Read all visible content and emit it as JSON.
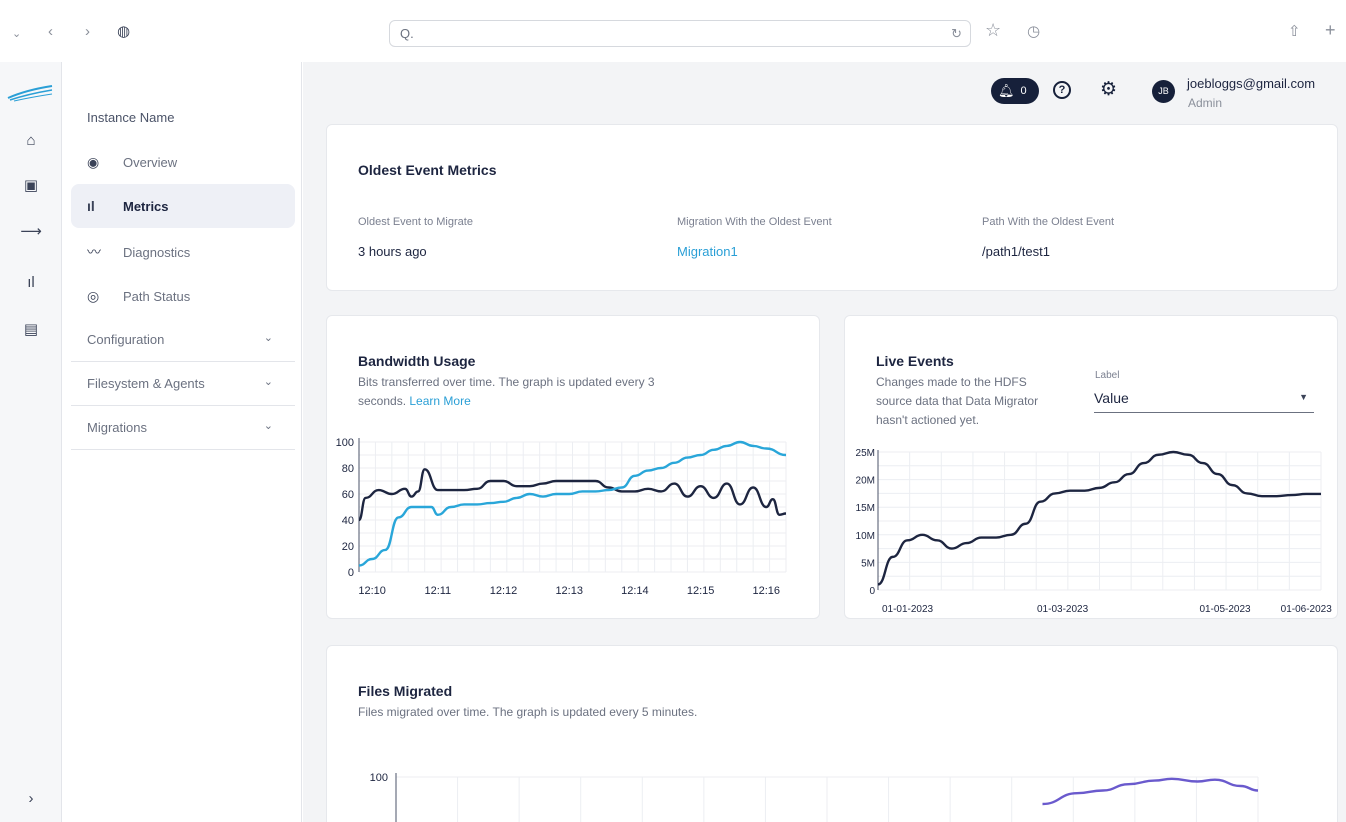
{
  "browser": {
    "url_text": "Q.",
    "icons": [
      "chevron-down-icon",
      "back-icon",
      "forward-icon",
      "globe-icon",
      "reload-icon",
      "star-icon",
      "history-icon",
      "share-icon",
      "new-tab-icon"
    ]
  },
  "rail": {
    "icons": [
      "logo-icon",
      "home-icon",
      "briefcase-icon",
      "arrow-right-icon",
      "bar-chart-icon",
      "document-icon",
      "expand-icon"
    ]
  },
  "sidebar": {
    "instance_name": "Instance Name",
    "items": [
      {
        "label": "Overview",
        "icon": "eye-icon"
      },
      {
        "label": "Metrics",
        "icon": "bar-chart-icon",
        "active": true
      },
      {
        "label": "Diagnostics",
        "icon": "trend-icon"
      },
      {
        "label": "Path Status",
        "icon": "target-icon"
      }
    ],
    "sections": [
      {
        "label": "Configuration"
      },
      {
        "label": "Filesystem & Agents"
      },
      {
        "label": "Migrations"
      }
    ]
  },
  "topbar": {
    "notification_count": "0",
    "avatar_initials": "JB",
    "user_email": "joebloggs@gmail.com",
    "user_role": "Admin"
  },
  "oldest": {
    "title": "Oldest Event Metrics",
    "metrics": [
      {
        "label": "Oldest Event to Migrate",
        "value": "3 hours ago"
      },
      {
        "label": "Migration With the Oldest Event",
        "value": "Migration1"
      },
      {
        "label": "Path With the Oldest Event",
        "value": "/path1/test1"
      }
    ]
  },
  "bandwidth": {
    "title": "Bandwidth Usage",
    "desc_line1": "Bits transferred over time. The graph is updated every 3",
    "desc_line2": "seconds.",
    "link": "Learn More"
  },
  "live_events": {
    "title": "Live Events",
    "desc_line1": "Changes made to the HDFS",
    "desc_line2": "source data that Data Migrator",
    "desc_line3": "hasn't actioned yet.",
    "select_label": "Label",
    "select_value": "Value"
  },
  "files": {
    "title": "Files Migrated",
    "desc": "Files migrated over time. The graph is updated every 5 minutes."
  },
  "colors": {
    "accent": "#2a9fd6",
    "navy": "#16203a",
    "purple": "#6a5acd"
  },
  "chart_data": [
    {
      "type": "line",
      "ylim": [
        0,
        100
      ],
      "yticks": [
        0,
        20,
        40,
        60,
        80,
        100
      ],
      "xticks": [
        "12:10",
        "12:11",
        "12:12",
        "12:13",
        "12:14",
        "12:15",
        "12:16"
      ],
      "grid": true,
      "series": [
        {
          "color": "#1d2540",
          "x": [
            0,
            0.1,
            0.3,
            0.5,
            0.7,
            0.8,
            0.9,
            1.0,
            1.2,
            1.4,
            1.6,
            1.8,
            2.0,
            2.2,
            2.4,
            2.6,
            2.8,
            3.0,
            3.2,
            3.4,
            3.6,
            3.8,
            4.0,
            4.2,
            4.4,
            4.6,
            4.8,
            5.0,
            5.2,
            5.4,
            5.6,
            5.8,
            6.0,
            6.2,
            6.3,
            6.4,
            6.5
          ],
          "y": [
            40,
            57,
            63,
            60,
            64,
            58,
            62,
            79,
            63,
            63,
            63,
            64,
            70,
            70,
            66,
            66,
            68,
            70,
            70,
            70,
            70,
            65,
            62,
            62,
            64,
            62,
            68,
            58,
            66,
            57,
            68,
            52,
            65,
            50,
            56,
            44,
            45
          ]
        },
        {
          "color": "#29a6d9",
          "x": [
            0,
            0.2,
            0.4,
            0.6,
            0.8,
            0.9,
            1.1,
            1.2,
            1.4,
            1.6,
            1.8,
            2.0,
            2.2,
            2.4,
            2.6,
            2.8,
            3.0,
            3.2,
            3.4,
            3.6,
            3.8,
            4.0,
            4.2,
            4.4,
            4.6,
            4.8,
            5.0,
            5.2,
            5.4,
            5.6,
            5.8,
            6.0,
            6.2,
            6.5
          ],
          "y": [
            5,
            10,
            17,
            42,
            50,
            50,
            50,
            44,
            50,
            52,
            52,
            53,
            54,
            57,
            60,
            58,
            60,
            60,
            62,
            62,
            63,
            65,
            74,
            78,
            80,
            84,
            88,
            90,
            94,
            97,
            100,
            97,
            95,
            90
          ]
        }
      ]
    },
    {
      "type": "line",
      "ylim": [
        0,
        25000000
      ],
      "yticks": [
        "0",
        "5M",
        "10M",
        "15M",
        "20M",
        "25M"
      ],
      "xticks": [
        "01-01-2023",
        "01-03-2023",
        "01-05-2023",
        "01-06-2023"
      ],
      "grid": true,
      "series": [
        {
          "color": "#1d2540",
          "x": [
            0,
            0.1,
            0.2,
            0.3,
            0.4,
            0.5,
            0.6,
            0.7,
            0.8,
            0.9,
            1.0,
            1.1,
            1.2,
            1.3,
            1.4,
            1.5,
            1.6,
            1.7,
            1.8,
            1.9,
            2.0,
            2.1,
            2.2,
            2.3,
            2.4,
            2.5,
            2.6,
            2.7,
            2.8,
            2.9,
            3.0
          ],
          "y": [
            1,
            6,
            9,
            10,
            9,
            7.5,
            8.5,
            9.5,
            9.5,
            10,
            12,
            16,
            17.5,
            18,
            18,
            18.5,
            19.5,
            21,
            23,
            24.5,
            25,
            24.5,
            23,
            21,
            19,
            17.5,
            17,
            17,
            17.2,
            17.4,
            17.4
          ]
        }
      ]
    },
    {
      "type": "line",
      "yticks": [
        100
      ],
      "grid": true,
      "series": [
        {
          "color": "#6a5acd",
          "x": [
            0.75,
            0.79,
            0.82,
            0.85,
            0.88,
            0.9,
            0.93,
            0.95,
            0.98,
            1.0
          ],
          "y": [
            70,
            82,
            85,
            92,
            96,
            98,
            95,
            97,
            90,
            85
          ]
        }
      ]
    }
  ]
}
